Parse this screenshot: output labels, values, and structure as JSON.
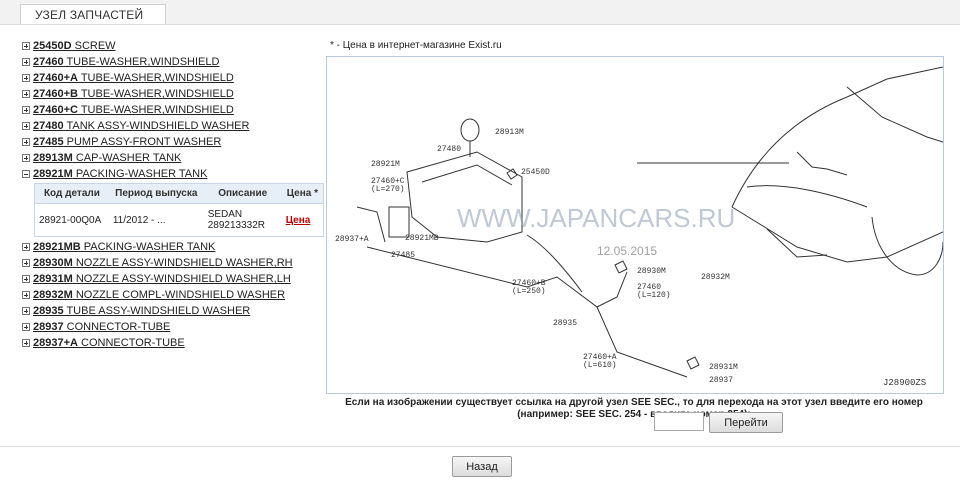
{
  "tab_label": "УЗЕЛ ЗАПЧАСТЕЙ",
  "parts": [
    {
      "code": "25450D",
      "name": "SCREW"
    },
    {
      "code": "27460",
      "name": "TUBE-WASHER,WINDSHIELD"
    },
    {
      "code": "27460+A",
      "name": "TUBE-WASHER,WINDSHIELD"
    },
    {
      "code": "27460+B",
      "name": "TUBE-WASHER,WINDSHIELD"
    },
    {
      "code": "27460+C",
      "name": "TUBE-WASHER,WINDSHIELD"
    },
    {
      "code": "27480",
      "name": "TANK ASSY-WINDSHIELD WASHER"
    },
    {
      "code": "27485",
      "name": "PUMP ASSY-FRONT WASHER"
    },
    {
      "code": "28913M",
      "name": "CAP-WASHER TANK"
    },
    {
      "code": "28921M",
      "name": "PACKING-WASHER TANK"
    },
    {
      "code": "28921MB",
      "name": "PACKING-WASHER TANK"
    },
    {
      "code": "28930M",
      "name": "NOZZLE ASSY-WINDSHIELD WASHER,RH"
    },
    {
      "code": "28931M",
      "name": "NOZZLE ASSY-WINDSHIELD WASHER,LH"
    },
    {
      "code": "28932M",
      "name": "NOZZLE COMPL-WINDSHIELD WASHER"
    },
    {
      "code": "28935",
      "name": "TUBE ASSY-WINDSHIELD WASHER"
    },
    {
      "code": "28937",
      "name": "CONNECTOR-TUBE"
    },
    {
      "code": "28937+A",
      "name": "CONNECTOR-TUBE"
    }
  ],
  "detail": {
    "headers": [
      "Код детали",
      "Период выпуска",
      "Описание",
      "Цена *"
    ],
    "row": {
      "code": "28921-00Q0A",
      "period": "11/2012 - ...",
      "desc": "SEDAN 289213332R",
      "price": "Цена"
    }
  },
  "note": "* - Цена в интернет-магазине Exist.ru",
  "diagram": {
    "watermark": "WWW.JAPANCARS.RU",
    "date": "12.05.2015",
    "code": "J28900ZS",
    "labels": [
      "28913M",
      "27480",
      "28921M",
      "27460+C",
      "(L=270)",
      "25450D",
      "28921MB",
      "28937+A",
      "27485",
      "27460+B",
      "(L=250)",
      "28930M",
      "28932M",
      "27460",
      "(L=120)",
      "28935",
      "27460+A",
      "(L=610)",
      "28931M",
      "28937"
    ]
  },
  "see_info": "Если на изображении существует ссылка на другой узел SEE SEC., то для перехода на этот узел введите его номер (например: SEE SEC. 254 - введите номер 254):",
  "go_button": "Перейти",
  "back_button": "Назад"
}
